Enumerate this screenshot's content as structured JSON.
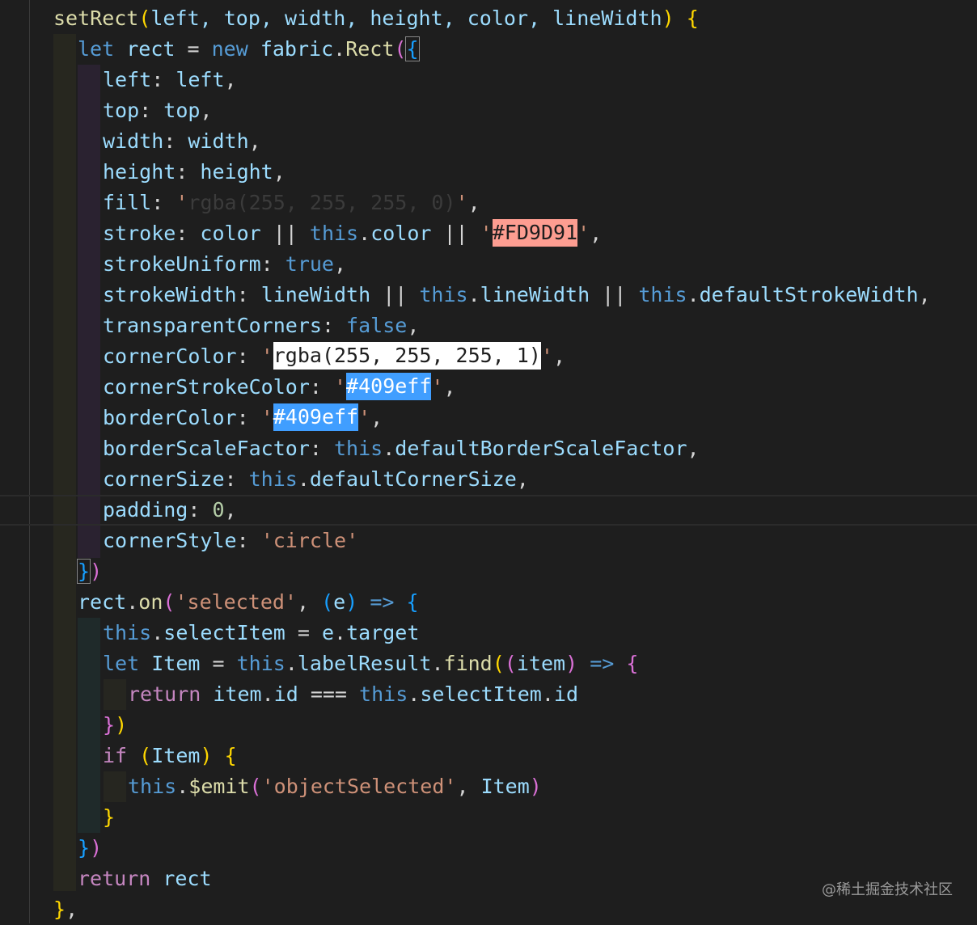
{
  "editor": {
    "theme_colors": {
      "background": "#1e1e1e",
      "function": "#dcdcaa",
      "variable": "#9cdcfe",
      "keyword": "#569cd6",
      "control": "#c586c0",
      "string": "#ce9178",
      "number": "#b5cea8",
      "bracket_level1": "#ffd700",
      "bracket_level2": "#da70d6",
      "bracket_level3": "#179fff"
    },
    "swatches": {
      "salmon": "#FD9D91",
      "white": "rgba(255, 255, 255, 1)",
      "blue": "#409eff"
    },
    "lines": {
      "l01": {
        "name": "setRect",
        "params": "left, top, width, height, color, lineWidth"
      },
      "l02": {
        "let": "let",
        "var": "rect",
        "new": "new",
        "obj": "fabric",
        "cls": "Rect"
      },
      "l03": {
        "key": "left",
        "val": "left"
      },
      "l04": {
        "key": "top",
        "val": "top"
      },
      "l05": {
        "key": "width",
        "val": "width"
      },
      "l06": {
        "key": "height",
        "val": "height"
      },
      "l07": {
        "key": "fill",
        "val": "rgba(255, 255, 255, 0)"
      },
      "l08": {
        "key": "stroke",
        "v1": "color",
        "v2": "this",
        "v3": "color",
        "v4": "#FD9D91"
      },
      "l09": {
        "key": "strokeUniform",
        "val": "true"
      },
      "l10": {
        "key": "strokeWidth",
        "v1": "lineWidth",
        "v2": "this",
        "v3": "lineWidth",
        "v4": "this",
        "v5": "defaultStrokeWidth"
      },
      "l11": {
        "key": "transparentCorners",
        "val": "false"
      },
      "l12": {
        "key": "cornerColor",
        "val": "rgba(255, 255, 255, 1)"
      },
      "l13": {
        "key": "cornerStrokeColor",
        "val": "#409eff"
      },
      "l14": {
        "key": "borderColor",
        "val": "#409eff"
      },
      "l15": {
        "key": "borderScaleFactor",
        "v1": "this",
        "v2": "defaultBorderScaleFactor"
      },
      "l16": {
        "key": "cornerSize",
        "v1": "this",
        "v2": "defaultCornerSize"
      },
      "l17": {
        "key": "padding",
        "val": "0"
      },
      "l18": {
        "key": "cornerStyle",
        "val": "circle"
      },
      "l19": {
        "close": "})"
      },
      "l20": {
        "obj": "rect",
        "fn": "on",
        "str": "selected",
        "param": "e"
      },
      "l21": {
        "this": "this",
        "prop": "selectItem",
        "rhs1": "e",
        "rhs2": "target"
      },
      "l22": {
        "let": "let",
        "var": "Item",
        "this": "this",
        "obj": "labelResult",
        "fn": "find",
        "param": "item"
      },
      "l23": {
        "ret": "return",
        "a1": "item",
        "a2": "id",
        "op": "===",
        "b1": "this",
        "b2": "selectItem",
        "b3": "id"
      },
      "l24": {
        "close": "})"
      },
      "l25": {
        "kw": "if",
        "var": "Item"
      },
      "l26": {
        "this": "this",
        "fn": "$emit",
        "str": "objectSelected",
        "arg": "Item"
      },
      "l27": {
        "close": "}"
      },
      "l28": {
        "close": "})"
      },
      "l29": {
        "ret": "return",
        "var": "rect"
      },
      "l30": {
        "close": "},"
      }
    }
  },
  "watermark": "@稀土掘金技术社区"
}
